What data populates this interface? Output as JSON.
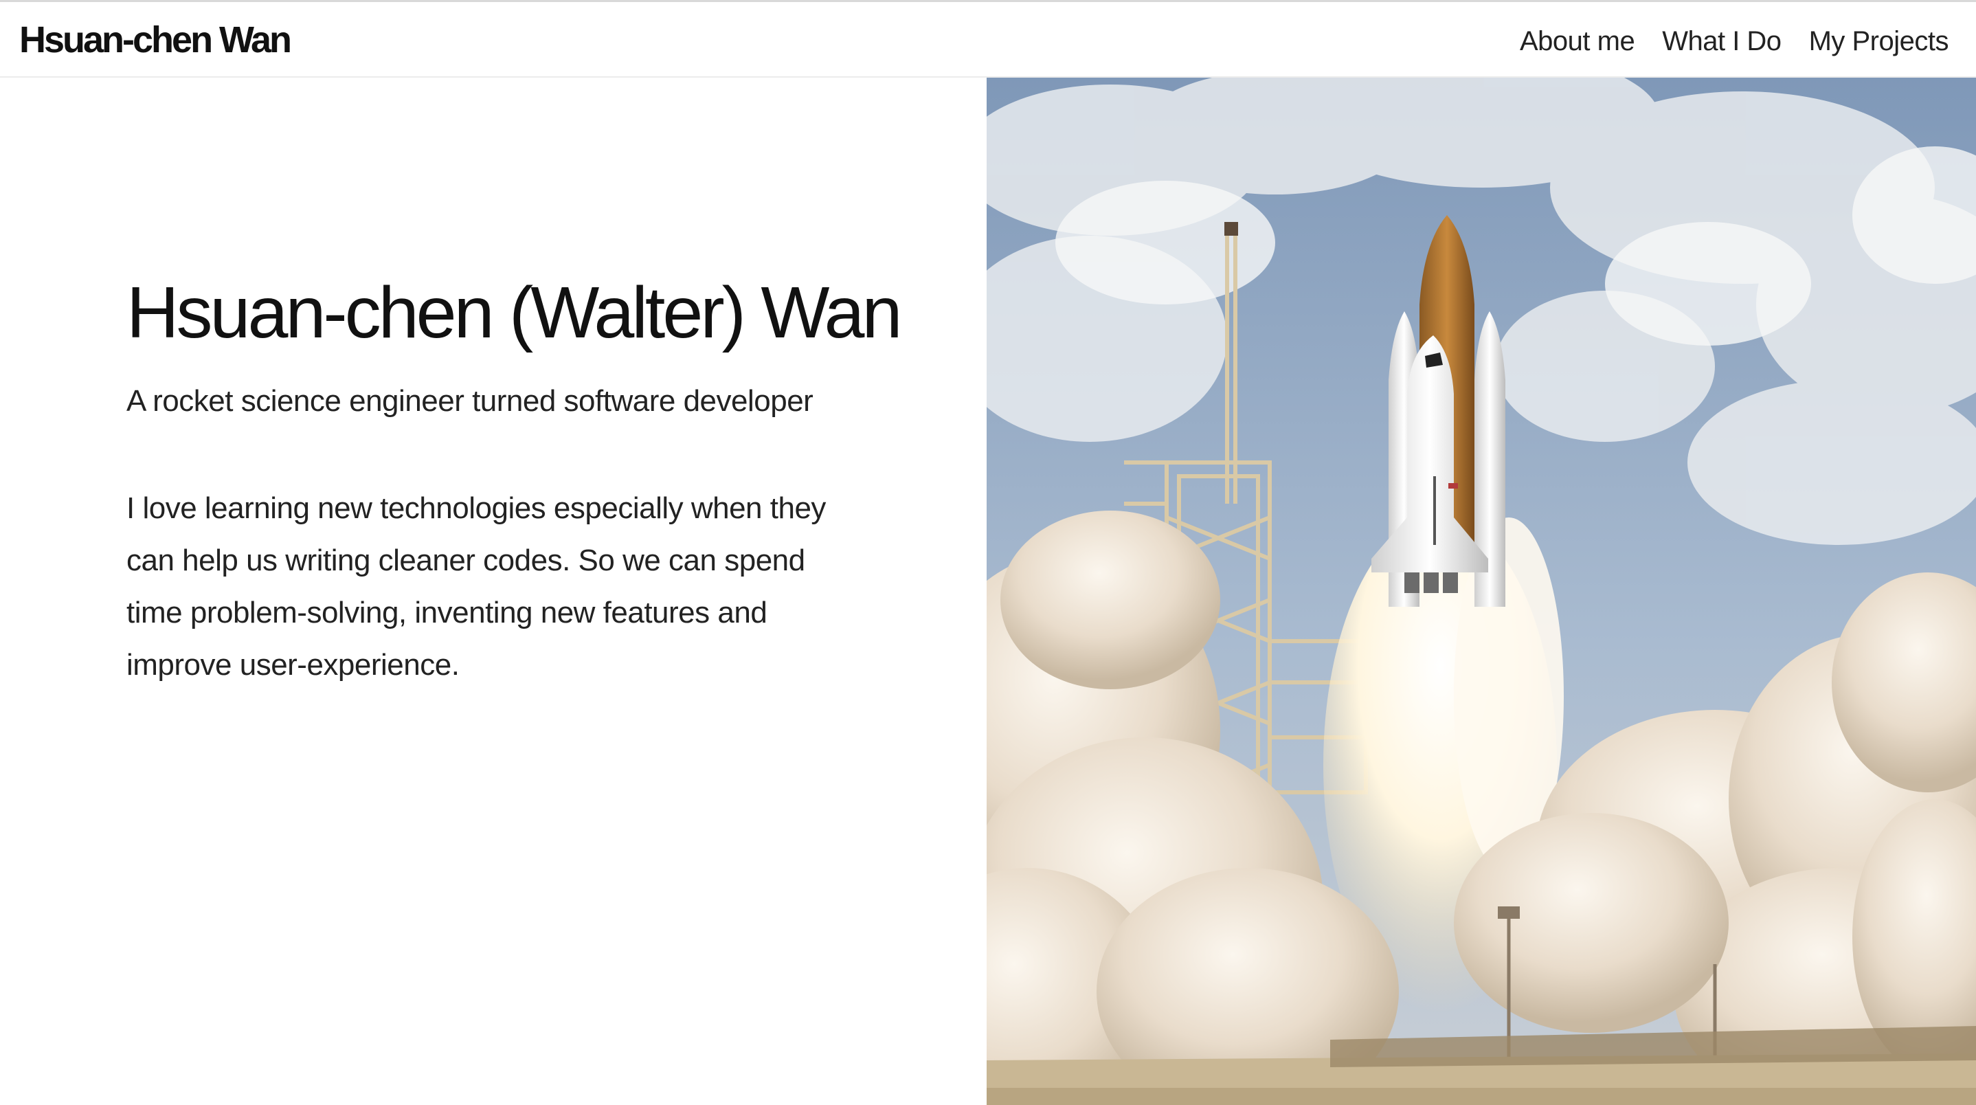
{
  "navbar": {
    "brand": "Hsuan-chen Wan",
    "links": [
      {
        "label": "About me"
      },
      {
        "label": "What I Do"
      },
      {
        "label": "My Projects"
      }
    ]
  },
  "hero": {
    "title": "Hsuan-chen (Walter) Wan",
    "subtitle": "A rocket science engineer turned software developer",
    "body": "I love learning new technologies especially when they can help us writing cleaner codes. So we can spend time problem-solving, inventing new features and improve user-experience."
  },
  "image": {
    "subject": "space-shuttle-launch-photo",
    "sky_color": "#8fa6c2",
    "smoke_color": "#efe6d6",
    "flame_color": "#fff8e6"
  }
}
